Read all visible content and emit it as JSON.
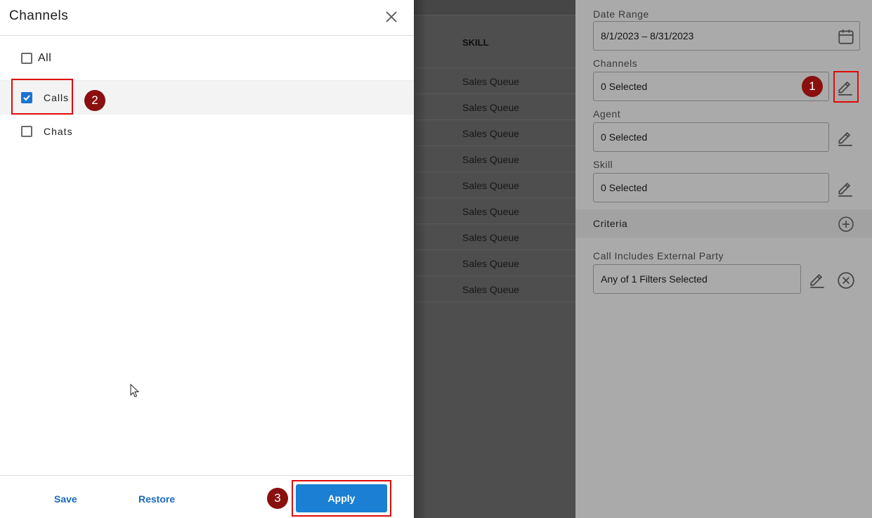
{
  "dialog": {
    "title": "Channels",
    "options": [
      {
        "label": "All",
        "checked": false
      },
      {
        "label": "Calls",
        "checked": true
      },
      {
        "label": "Chats",
        "checked": false
      }
    ],
    "footer": {
      "save_label": "Save",
      "restore_label": "Restore",
      "apply_label": "Apply"
    }
  },
  "table": {
    "column_header": "SKILL",
    "rows": [
      "Sales Queue",
      "Sales Queue",
      "Sales Queue",
      "Sales Queue",
      "Sales Queue",
      "Sales Queue",
      "Sales Queue",
      "Sales Queue",
      "Sales Queue"
    ]
  },
  "filters": {
    "date_range": {
      "label": "Date Range",
      "value": "8/1/2023 – 8/31/2023"
    },
    "channels": {
      "label": "Channels",
      "value": "0 Selected"
    },
    "agent": {
      "label": "Agent",
      "value": "0 Selected"
    },
    "skill": {
      "label": "Skill",
      "value": "0 Selected"
    },
    "criteria": {
      "label": "Criteria"
    },
    "external_party": {
      "label": "Call Includes External Party",
      "value": "Any of 1 Filters Selected"
    }
  },
  "steps": [
    "1",
    "2",
    "3"
  ],
  "colors": {
    "accent": "#1b7fd4",
    "step_badge": "#8a0f0f",
    "highlight_box": "#e00b0b",
    "overlay_panel": "#aaaaaa",
    "overlay_table": "#4e4e4e"
  },
  "icons": [
    "close-icon",
    "calendar-icon",
    "pencil-icon",
    "plus-circle-icon",
    "x-circle-icon",
    "checkmark-icon",
    "mouse-cursor-icon"
  ]
}
